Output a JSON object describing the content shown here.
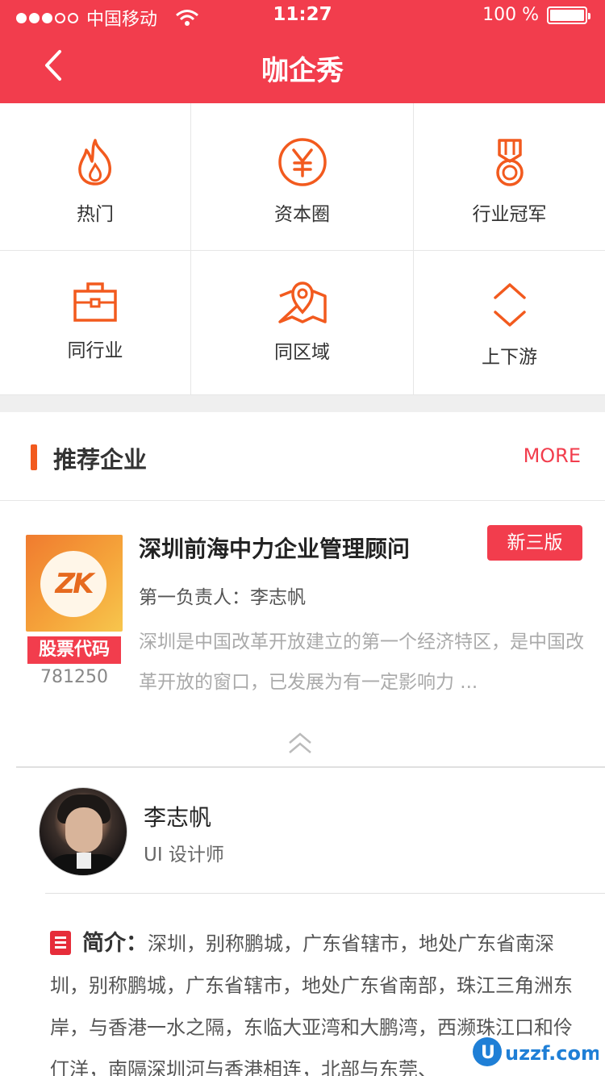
{
  "status_bar": {
    "carrier": "中国移动",
    "time": "11:27",
    "battery": "100 %"
  },
  "nav": {
    "title": "咖企秀"
  },
  "categories": [
    {
      "label": "热门",
      "icon": "flame-icon"
    },
    {
      "label": "资本圈",
      "icon": "yen-icon"
    },
    {
      "label": "行业冠军",
      "icon": "medal-icon"
    },
    {
      "label": "同行业",
      "icon": "briefcase-icon"
    },
    {
      "label": "同区域",
      "icon": "map-pin-icon"
    },
    {
      "label": "上下游",
      "icon": "up-down-arrows-icon"
    }
  ],
  "section": {
    "title": "推荐企业",
    "more": "MORE"
  },
  "company": {
    "logo_text": "ZK",
    "name": "深圳前海中力企业管理顾问",
    "tag": "新三版",
    "owner": "第一负责人：李志帆",
    "description": "深圳是中国改革开放建立的第一个经济特区，是中国改革开放的窗口，已发展为有一定影响力 ...",
    "stock_label": "股票代码",
    "stock_code": "781250"
  },
  "person": {
    "name": "李志帆",
    "title": "UI 设计师"
  },
  "intro": {
    "label": "简介：",
    "text": "深圳，别称鹏城，广东省辖市，地处广东省南深圳，别称鹏城，广东省辖市，地处广东省南部，珠江三角洲东岸，与香港一水之隔，东临大亚湾和大鹏湾，西濒珠江口和伶仃洋，南隔深圳河与香港相连，北部与东莞、"
  },
  "watermark": "uzzf.com",
  "colors": {
    "brand_red": "#f23d4d",
    "icon_orange": "#f25a1e"
  }
}
